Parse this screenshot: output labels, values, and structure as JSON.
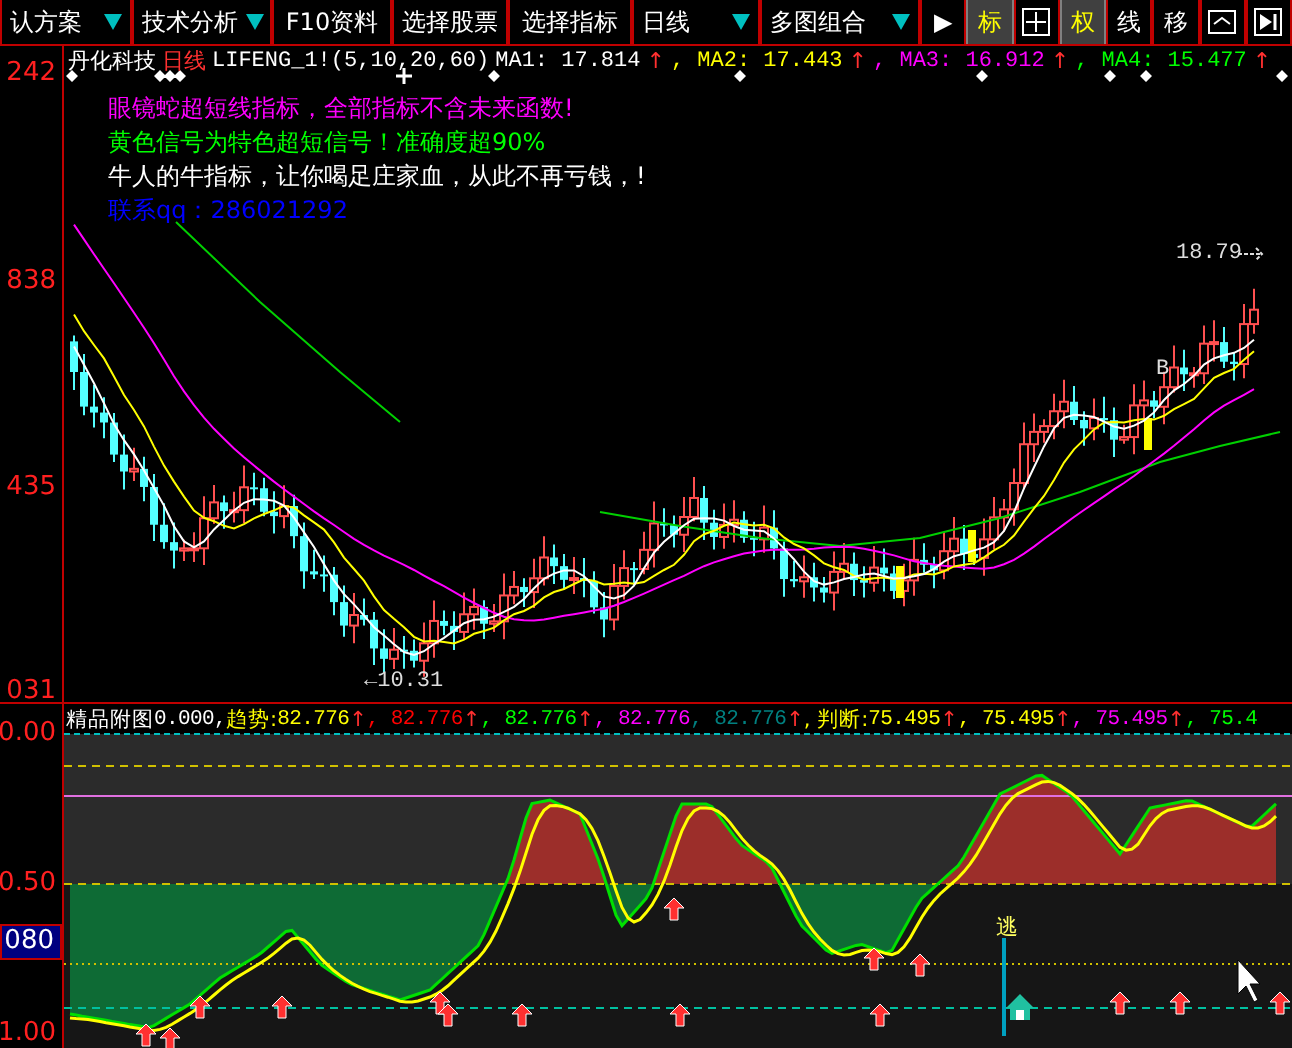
{
  "toolbar": [
    {
      "label": "认方案",
      "kind": "dropdown",
      "selected": false
    },
    {
      "label": "技术分析",
      "kind": "dropdown",
      "selected": false
    },
    {
      "label": "F10资料",
      "kind": "text",
      "selected": false
    },
    {
      "label": "选择股票",
      "kind": "text",
      "selected": false
    },
    {
      "label": "选择指标",
      "kind": "text",
      "selected": false
    },
    {
      "label": "日线",
      "kind": "dropdown",
      "selected": false
    },
    {
      "label": "多图组合",
      "kind": "dropdown",
      "selected": false
    },
    {
      "label": "▶",
      "kind": "text",
      "selected": false
    },
    {
      "label": "标",
      "kind": "text",
      "selected": true
    },
    {
      "kind": "grid-icon",
      "selected": false
    },
    {
      "label": "权",
      "kind": "text",
      "selected": true
    },
    {
      "label": "线",
      "kind": "text",
      "selected": false
    },
    {
      "label": "移",
      "kind": "text",
      "selected": false
    },
    {
      "kind": "window-icon",
      "selected": false
    },
    {
      "kind": "play-icon",
      "selected": false
    }
  ],
  "stock_header": {
    "name": "丹化科技",
    "period": "日线",
    "indicator": "LIFENG_1!(5,10,20,60)",
    "ma": [
      {
        "text": "MA1: 17.814",
        "color": "#ffffff",
        "arrow": "↑"
      },
      {
        "text": ", MA2: 17.443",
        "color": "#ffff00",
        "arrow": "↑"
      },
      {
        "text": ", MA3: 16.912",
        "color": "#ff00ff",
        "arrow": "↑"
      },
      {
        "text": ", MA4: 15.477",
        "color": "#00ff00",
        "arrow": "↑"
      }
    ]
  },
  "notes": [
    {
      "text": "眼镜蛇超短线指标，全部指标不含未来函数!",
      "color": "#ff00ff"
    },
    {
      "text": "黄色信号为特色超短信号！准确度超90%",
      "color": "#00ff00"
    },
    {
      "text": "牛人的牛指标，让你喝足庄家血，从此不再亏钱，!",
      "color": "#ffffff"
    },
    {
      "text": "联系qq：286021292",
      "color": "#0000ff"
    }
  ],
  "price_axis": [
    "242",
    "838",
    "435",
    "031"
  ],
  "price_labels": {
    "high": "18.79",
    "low": "←10.31",
    "signal": "B"
  },
  "sub_header": {
    "title": "精品附图",
    "value": "0.000,",
    "trend_label": "趋势:",
    "trend_values": [
      {
        "text": "82.776",
        "color": "#ffff00",
        "arrow": "↑"
      },
      {
        "text": ", 82.776",
        "color": "#ff0000",
        "arrow": "↑"
      },
      {
        "text": ", 82.776",
        "color": "#00ff00",
        "arrow": "↑"
      },
      {
        "text": ", 82.776",
        "color": "#ff00ff"
      },
      {
        "text": ", 82.776",
        "color": "#008080",
        "arrow": "↑"
      }
    ],
    "judge_label": ", 判断:",
    "judge_values": [
      {
        "text": "75.495",
        "color": "#ffff00",
        "arrow": "↑"
      },
      {
        "text": ", 75.495",
        "color": "#ffff00",
        "arrow": "↑"
      },
      {
        "text": ", 75.495",
        "color": "#ff00ff",
        "arrow": "↑"
      },
      {
        "text": ", 75.4",
        "color": "#00ff00"
      }
    ]
  },
  "sub_axis": [
    {
      "text": "0.00",
      "kind": "plain"
    },
    {
      "text": "0.50",
      "kind": "plain"
    },
    {
      "text": "080",
      "kind": "boxed"
    },
    {
      "text": "1.00",
      "kind": "plain"
    }
  ],
  "escape_label": "逃"
}
